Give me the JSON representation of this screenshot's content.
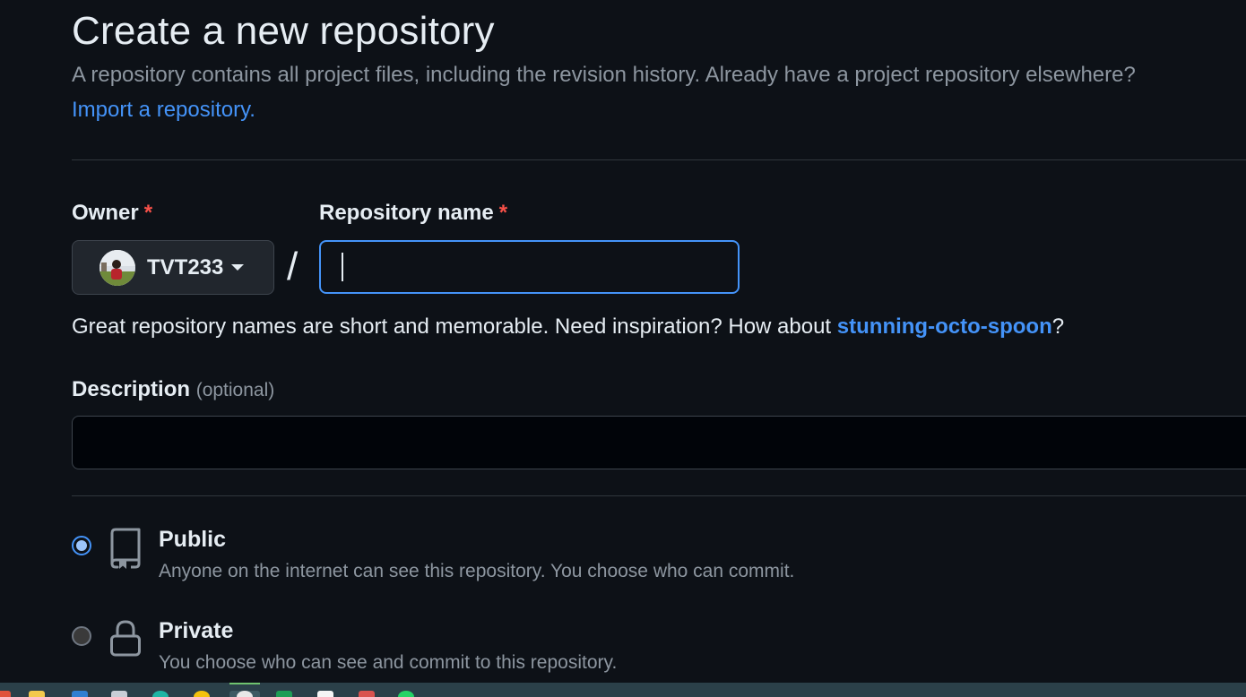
{
  "header": {
    "title": "Create a new repository",
    "subtitle": "A repository contains all project files, including the revision history. Already have a project repository elsewhere?",
    "import_link": "Import a repository."
  },
  "owner": {
    "label": "Owner",
    "required_mark": "*",
    "name": "TVT233"
  },
  "separator": "/",
  "repo_name": {
    "label": "Repository name",
    "required_mark": "*",
    "value": ""
  },
  "hint": {
    "prefix": "Great repository names are short and memorable. Need inspiration? How about ",
    "suggestion": "stunning-octo-spoon",
    "suffix": "?"
  },
  "description": {
    "label": "Description",
    "optional": "(optional)",
    "value": ""
  },
  "visibility": {
    "public": {
      "title": "Public",
      "desc": "Anyone on the internet can see this repository. You choose who can commit.",
      "selected": true,
      "icon": "repo-icon"
    },
    "private": {
      "title": "Private",
      "desc": "You choose who can see and commit to this repository.",
      "selected": false,
      "icon": "lock-icon"
    }
  },
  "colors": {
    "background": "#0d1117",
    "accent": "#4493f8",
    "required": "#f85149",
    "muted_text": "#8d96a0"
  },
  "taskbar": {
    "icons": [
      "start-icon",
      "file-explorer-icon",
      "mail-icon",
      "app-icon",
      "edge-icon",
      "chrome-icon",
      "chrome-profile-icon",
      "sheets-icon",
      "notion-icon",
      "pen-icon",
      "whatsapp-icon"
    ]
  }
}
